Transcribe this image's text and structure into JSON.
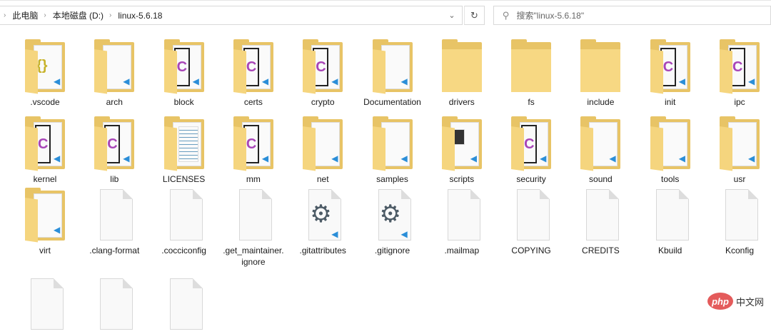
{
  "address_bar": {
    "breadcrumbs": [
      "此电脑",
      "本地磁盘 (D:)",
      "linux-5.6.18"
    ]
  },
  "search": {
    "placeholder": "搜索\"linux-5.6.18\""
  },
  "colors": {
    "folder": "#e8c466",
    "c_accent": "#a845b8",
    "vscode_blue": "#2b8ed8"
  },
  "items": [
    {
      "name": ".vscode",
      "icon": "folder-json"
    },
    {
      "name": "arch",
      "icon": "folder-doc"
    },
    {
      "name": "block",
      "icon": "folder-c"
    },
    {
      "name": "certs",
      "icon": "folder-c"
    },
    {
      "name": "crypto",
      "icon": "folder-c"
    },
    {
      "name": "Documentation",
      "icon": "folder-doc"
    },
    {
      "name": "drivers",
      "icon": "folder-empty"
    },
    {
      "name": "fs",
      "icon": "folder-empty"
    },
    {
      "name": "include",
      "icon": "folder-empty"
    },
    {
      "name": "init",
      "icon": "folder-c"
    },
    {
      "name": "ipc",
      "icon": "folder-c"
    },
    {
      "name": "kernel",
      "icon": "folder-c"
    },
    {
      "name": "lib",
      "icon": "folder-c"
    },
    {
      "name": "LICENSES",
      "icon": "folder-text"
    },
    {
      "name": "mm",
      "icon": "folder-c"
    },
    {
      "name": "net",
      "icon": "folder-doc"
    },
    {
      "name": "samples",
      "icon": "folder-doc"
    },
    {
      "name": "scripts",
      "icon": "folder-script"
    },
    {
      "name": "security",
      "icon": "folder-c"
    },
    {
      "name": "sound",
      "icon": "folder-doc"
    },
    {
      "name": "tools",
      "icon": "folder-doc"
    },
    {
      "name": "usr",
      "icon": "folder-doc"
    },
    {
      "name": "virt",
      "icon": "folder-doc"
    },
    {
      "name": ".clang-format",
      "icon": "file"
    },
    {
      "name": ".cocciconfig",
      "icon": "file"
    },
    {
      "name": ".get_maintainer.\nignore",
      "icon": "file"
    },
    {
      "name": ".gitattributes",
      "icon": "file-gear"
    },
    {
      "name": ".gitignore",
      "icon": "file-gear"
    },
    {
      "name": ".mailmap",
      "icon": "file"
    },
    {
      "name": "COPYING",
      "icon": "file"
    },
    {
      "name": "CREDITS",
      "icon": "file"
    },
    {
      "name": "Kbuild",
      "icon": "file"
    },
    {
      "name": "Kconfig",
      "icon": "file"
    },
    {
      "name": "",
      "icon": "file"
    },
    {
      "name": "",
      "icon": "file"
    },
    {
      "name": "",
      "icon": "file"
    }
  ],
  "watermark": {
    "logo": "php",
    "text": "中文网"
  }
}
